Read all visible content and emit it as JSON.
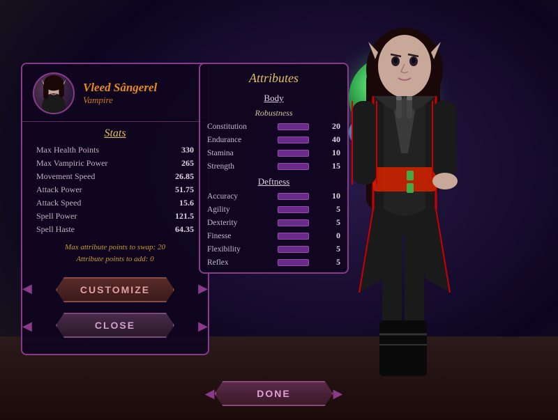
{
  "character": {
    "name": "Vleed Sângerel",
    "class": "Vampire",
    "avatar_label": "character avatar"
  },
  "stats": {
    "title": "Stats",
    "rows": [
      {
        "label": "Max Health Points",
        "value": "330"
      },
      {
        "label": "Max Vampiric Power",
        "value": "265"
      },
      {
        "label": "Movement Speed",
        "value": "26.85"
      },
      {
        "label": "Attack Power",
        "value": "51.75"
      },
      {
        "label": "Attack Speed",
        "value": "15.6"
      },
      {
        "label": "Spell Power",
        "value": "121.5"
      },
      {
        "label": "Spell Haste",
        "value": "64.35"
      }
    ],
    "note_line1": "Max attribute points to swap: 20",
    "note_line2": "Attribute points to add: 0"
  },
  "buttons": {
    "customize": "CUSTOMIZE",
    "close": "CLOSE",
    "done": "DONE"
  },
  "attributes": {
    "title": "Attributes",
    "sections": [
      {
        "name": "Body",
        "subsections": [
          {
            "name": "Robustness",
            "attrs": [
              {
                "label": "Constitution",
                "value": "20"
              },
              {
                "label": "Endurance",
                "value": "40"
              },
              {
                "label": "Stamina",
                "value": "10"
              },
              {
                "label": "Strength",
                "value": "15"
              }
            ]
          }
        ]
      },
      {
        "name": "Deftness",
        "subsections": [
          {
            "name": "",
            "attrs": [
              {
                "label": "Accuracy",
                "value": "10"
              },
              {
                "label": "Agility",
                "value": "5"
              },
              {
                "label": "Dexterity",
                "value": "5"
              },
              {
                "label": "Finesse",
                "value": "0"
              },
              {
                "label": "Flexibility",
                "value": "5"
              },
              {
                "label": "Reflex",
                "value": "5"
              }
            ]
          }
        ]
      }
    ]
  },
  "colors": {
    "accent_orange": "#e88a20",
    "accent_purple": "#8b3a8b",
    "panel_bg": "rgba(15,5,30,0.92)",
    "text_light": "#e0d0e0"
  }
}
